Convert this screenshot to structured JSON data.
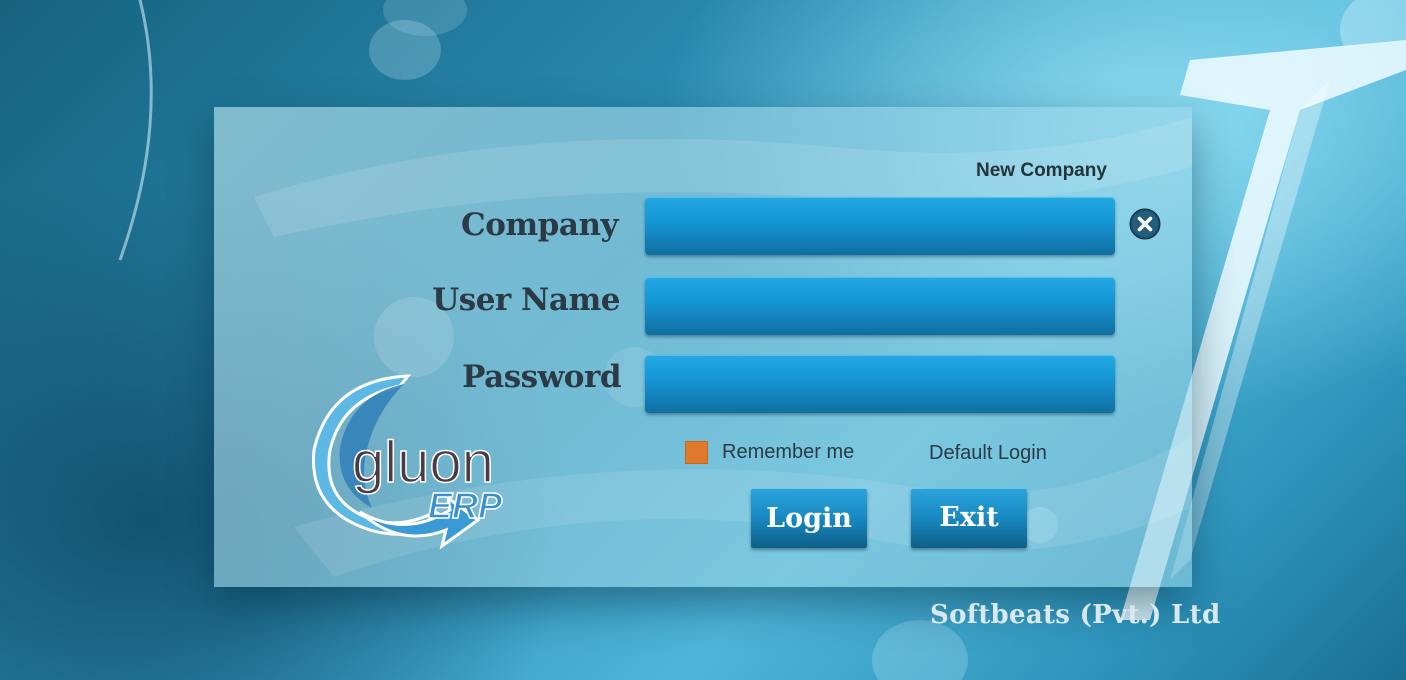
{
  "login": {
    "new_company_link": "New Company",
    "fields": {
      "company_label": "Company",
      "username_label": "User Name",
      "password_label": "Password",
      "company_value": "",
      "username_value": "",
      "password_value": ""
    },
    "remember_label": "Remember me",
    "remember_checked": true,
    "default_login_link": "Default Login",
    "login_button": "Login",
    "exit_button": "Exit"
  },
  "logo": {
    "wordmark": "gluon",
    "suffix": "ERP"
  },
  "footer": {
    "company": "Softbeats (Pvt.) Ltd"
  },
  "icons": {
    "clear": "close-circle-icon"
  },
  "colors": {
    "field_blue": "#1598d6",
    "button_blue": "#1a8cc5",
    "checkbox_orange": "#e07a2a",
    "label_dark": "#2b3a44"
  }
}
